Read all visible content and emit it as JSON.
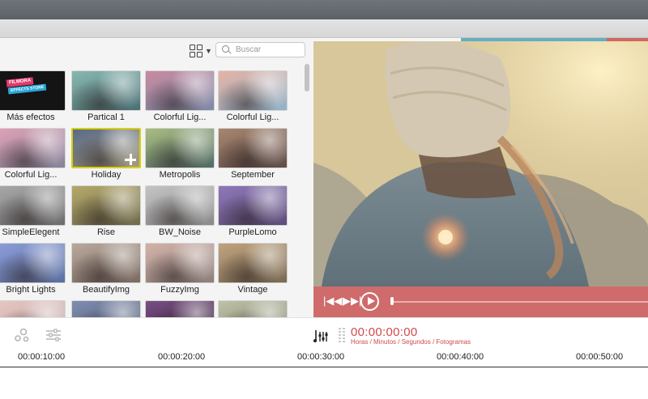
{
  "search": {
    "placeholder": "Buscar"
  },
  "effects": [
    {
      "label": "Más efectos",
      "store_line1": "FILMORA",
      "store_line2": "EFFECTS STORE"
    },
    {
      "label": "Partical 1"
    },
    {
      "label": "Colorful Lig..."
    },
    {
      "label": "Colorful Lig..."
    },
    {
      "label": "Colorful Lig..."
    },
    {
      "label": "Holiday",
      "selected": true
    },
    {
      "label": "Metropolis"
    },
    {
      "label": "September"
    },
    {
      "label": "SimpleElegent"
    },
    {
      "label": "Rise"
    },
    {
      "label": "BW_Noise"
    },
    {
      "label": "PurpleLomo"
    },
    {
      "label": "Bright Lights"
    },
    {
      "label": "BeautifyImg"
    },
    {
      "label": "FuzzyImg"
    },
    {
      "label": "Vintage"
    },
    {
      "label": ""
    },
    {
      "label": ""
    },
    {
      "label": ""
    },
    {
      "label": ""
    }
  ],
  "playback": {
    "position_fraction": 0.0
  },
  "timecode": {
    "value": "00:00:00:00",
    "hint": "Horas / Minutos / Segundos / Fotogramas"
  },
  "ruler": [
    "00:00:10:00",
    "00:00:20:00",
    "00:00:30:00",
    "00:00:40:00",
    "00:00:50:00"
  ],
  "colors": {
    "accent_red": "#cf6b6b",
    "timecode_red": "#cf4a4a",
    "stripe_blue": "#64aec3",
    "selection_yellow": "#d8d000"
  },
  "icons": [
    "grid-view-icon",
    "search-icon",
    "skip-back-icon",
    "skip-forward-icon",
    "play-icon",
    "effects-icon",
    "adjust-icon",
    "audio-mixer-icon"
  ]
}
